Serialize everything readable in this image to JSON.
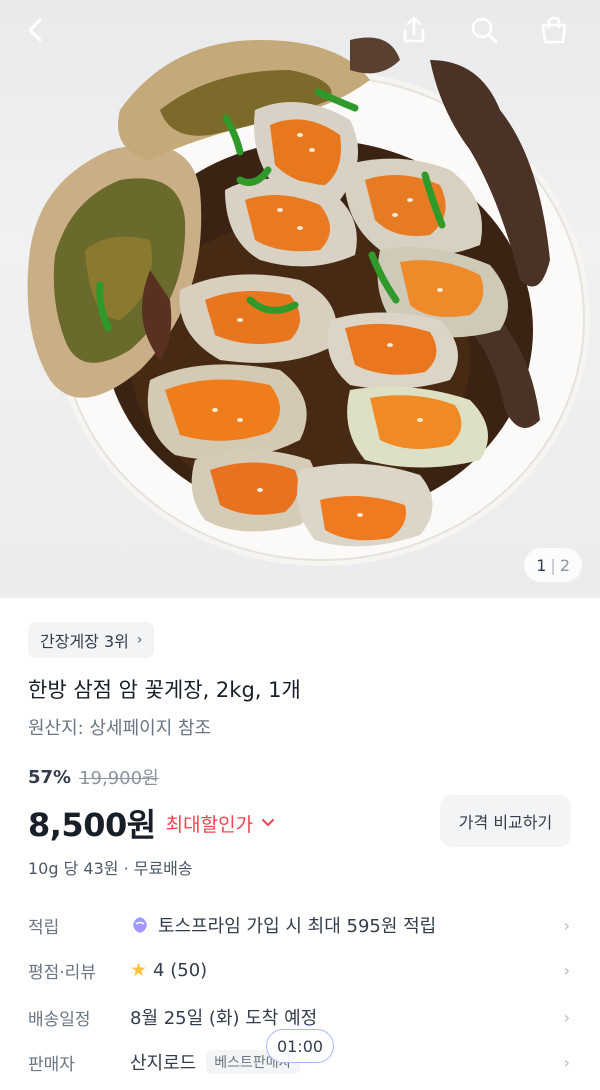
{
  "nav": {
    "back_icon": "chevron-left-icon",
    "share_icon": "share-icon",
    "search_icon": "search-icon",
    "cart_icon": "shopping-bag-icon"
  },
  "gallery": {
    "current": "1",
    "total": "2"
  },
  "product": {
    "rank_label": "간장게장 3위",
    "title": "한방 삼점 암 꽃게장, 2kg, 1개",
    "origin": "원산지: 상세페이지 참조",
    "discount_rate": "57%",
    "original_price": "19,900원",
    "price": "8,500원",
    "best_price_label": "최대할인가",
    "compare_label": "가격 비교하기",
    "unit_shipping": "10g 당 43원 · 무료배송"
  },
  "info": {
    "points_key": "적립",
    "points_value": "토스프라임 가입 시 최대 595원 적립",
    "rating_key": "평점·리뷰",
    "rating_value": "4 (50)",
    "delivery_key": "배송일정",
    "delivery_value": "8월 25일 (화) 도착 예정",
    "seller_key": "판매자",
    "seller_value": "산지로드",
    "seller_tag": "베스트판매자"
  },
  "overlay": {
    "time": "01:00"
  },
  "colors": {
    "accent_red": "#f04452",
    "star": "#ffc342",
    "chip_bg": "#f2f4f6"
  }
}
